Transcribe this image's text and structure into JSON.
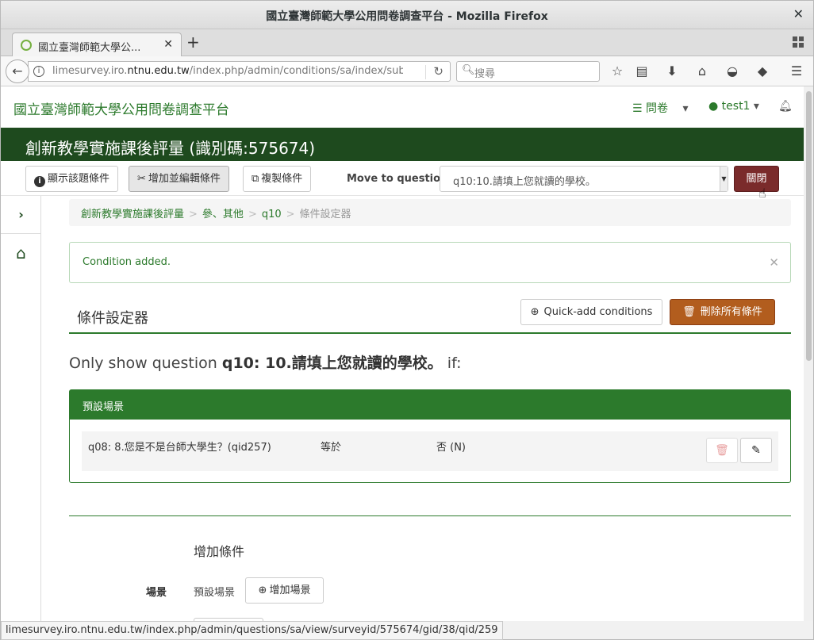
{
  "window": {
    "title": "國立臺灣師範大學公用問卷調查平台 - Mozilla Firefox"
  },
  "tab": {
    "label": "國立臺灣師範大學公..."
  },
  "navbar": {
    "url_prefix": "limesurvey.iro.",
    "url_domain": "ntnu.edu.tw",
    "url_path": "/index.php/admin/conditions/sa/index/suba",
    "search_placeholder": "搜尋"
  },
  "site": {
    "brand": "國立臺灣師範大學公用問卷調查平台",
    "menu_survey": "問卷",
    "menu_user": "test1"
  },
  "survey": {
    "title": "創新教學實施課後評量 (識別碼:575674)"
  },
  "toolbar": {
    "show_conditions": "顯示該題條件",
    "add_edit_conditions": "增加並編輯條件",
    "copy_conditions": "複製條件",
    "move_label": "Move to question:",
    "move_value": "q10:10.請填上您就讀的學校。",
    "close": "關閉"
  },
  "breadcrumb": {
    "items": [
      "創新教學實施課後評量",
      "參、其他",
      "q10",
      "條件設定器"
    ]
  },
  "alert": {
    "message": "Condition added."
  },
  "section": {
    "title": "條件設定器",
    "quick_add": "Quick-add conditions",
    "delete_all": "刪除所有條件",
    "only_show_prefix": "Only show question ",
    "only_show_question": "q10: 10.請填上您就讀的學校。",
    "only_show_suffix": " if:"
  },
  "scenario_panel": {
    "heading": "預設場景",
    "condition": {
      "question": "q08: 8.您是不是台師大學生？(qid257)",
      "operator": "等於",
      "answer": "否 (N)"
    }
  },
  "add_condition": {
    "title": "增加條件",
    "scene_label": "場景",
    "scene_value": "預設場景",
    "add_scene": "增加場景"
  },
  "statusbar": {
    "url": "limesurvey.iro.ntnu.edu.tw/index.php/admin/questions/sa/view/surveyid/575674/gid/38/qid/259"
  },
  "colors": {
    "brand_green": "#2c7a2c",
    "header_dark_green": "#1e4a1e",
    "close_button": "#7a2b2b",
    "delete_all_button": "#b25d1e"
  },
  "icons": {
    "back": "arrow-left-icon",
    "info": "info-icon",
    "reload": "reload-icon",
    "bookmark": "star-icon",
    "home": "home-icon",
    "bell": "bell-icon",
    "trash": "trash-icon",
    "edit": "pencil-icon"
  }
}
